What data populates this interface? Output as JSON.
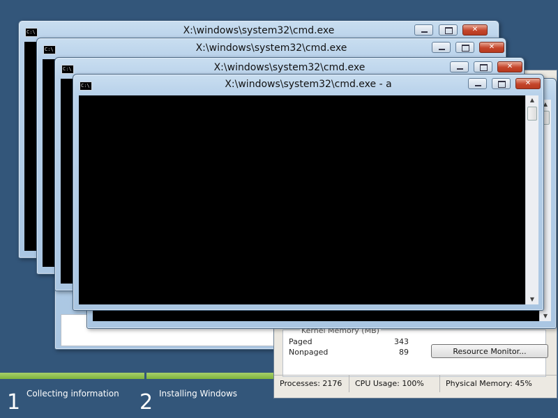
{
  "windows": {
    "cmd1": {
      "title": "X:\\windows\\system32\\cmd.exe",
      "icon": "cmd-icon"
    },
    "cmd2": {
      "title": "X:\\windows\\system32\\cmd.exe",
      "icon": "cmd-icon"
    },
    "cmd3": {
      "title": "X:\\windows\\system32\\cmd.exe",
      "icon": "cmd-icon"
    },
    "cmd4": {
      "title": "X:\\windows\\system32\\cmd.exe - a",
      "icon": "cmd-icon"
    }
  },
  "task_manager": {
    "kernel_memory_label": "Kernel Memory (MB)",
    "paged_label": "Paged",
    "paged_value": "343",
    "nonpaged_label": "Nonpaged",
    "nonpaged_value": "89",
    "resource_monitor_label": "Resource Monitor...",
    "status": {
      "processes": "Processes: 2176",
      "cpu": "CPU Usage: 100%",
      "memory": "Physical Memory: 45%"
    }
  },
  "setup": {
    "steps": [
      {
        "num": "1",
        "label": "Collecting information"
      },
      {
        "num": "2",
        "label": "Installing Windows"
      }
    ],
    "progress_color": "#8ec04f"
  },
  "colors": {
    "desktop": "#33567a",
    "console": "#000000",
    "close_button": "#c4452b"
  }
}
